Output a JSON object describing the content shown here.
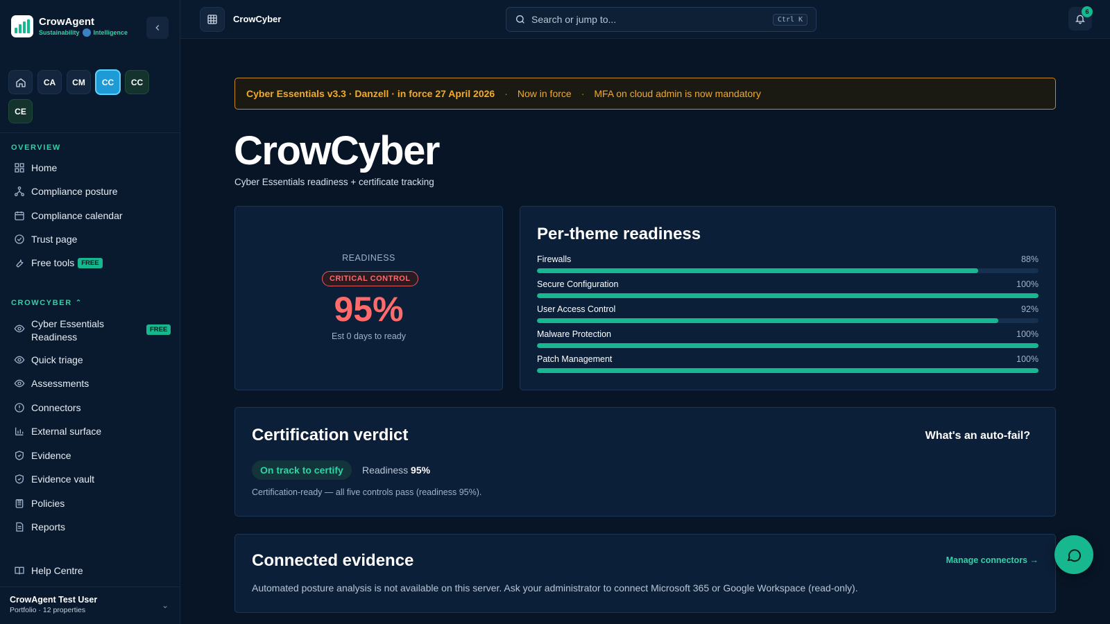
{
  "brand": {
    "name": "CrowAgent",
    "sub_left": "Sustainability",
    "sub_right": "Intelligence"
  },
  "app_switcher": [
    {
      "label": "",
      "icon": "home-icon"
    },
    {
      "label": "CA"
    },
    {
      "label": "CM"
    },
    {
      "label": "CC",
      "active": true
    },
    {
      "label": "CC"
    },
    {
      "label": "CE"
    }
  ],
  "sidebar": {
    "overview_label": "OVERVIEW",
    "overview_items": [
      {
        "label": "Home",
        "icon": "grid-icon"
      },
      {
        "label": "Compliance posture",
        "icon": "sitemap-icon"
      },
      {
        "label": "Compliance calendar",
        "icon": "calendar-icon"
      },
      {
        "label": "Trust page",
        "icon": "check-circle-icon"
      },
      {
        "label": "Free tools",
        "icon": "wrench-icon",
        "badge": "FREE"
      }
    ],
    "section_label": "CROWCYBER",
    "section_items": [
      {
        "label": "Cyber Essentials Readiness",
        "icon": "eye-icon",
        "badge": "FREE"
      },
      {
        "label": "Quick triage",
        "icon": "eye-icon"
      },
      {
        "label": "Assessments",
        "icon": "eye-icon"
      },
      {
        "label": "Connectors",
        "icon": "alert-circle-icon"
      },
      {
        "label": "External surface",
        "icon": "bar-chart-icon"
      },
      {
        "label": "Evidence",
        "icon": "shield-check-icon"
      },
      {
        "label": "Evidence vault",
        "icon": "shield-check-icon"
      },
      {
        "label": "Policies",
        "icon": "clipboard-icon"
      },
      {
        "label": "Reports",
        "icon": "document-icon"
      }
    ],
    "help_label": "Help Centre",
    "user_name": "CrowAgent Test User",
    "user_sub": "Portfolio · 12 properties"
  },
  "topbar": {
    "title": "CrowCyber",
    "search_placeholder": "Search or jump to...",
    "search_shortcut": "Ctrl K",
    "notification_count": "6"
  },
  "banner": {
    "headline": "Cyber Essentials v3.3 · Danzell · in force 27 April 2026",
    "status": "Now in force",
    "note": "MFA on cloud admin is now mandatory",
    "separator": "·"
  },
  "page": {
    "title": "CrowCyber",
    "subtitle": "Cyber Essentials readiness + certificate tracking"
  },
  "readiness": {
    "label": "READINESS",
    "badge": "CRITICAL CONTROL",
    "value": "95%",
    "estimate": "Est 0 days to ready"
  },
  "themes": {
    "title": "Per-theme readiness",
    "rows": [
      {
        "name": "Firewalls",
        "value": "88%",
        "pct": 88
      },
      {
        "name": "Secure Configuration",
        "value": "100%",
        "pct": 100
      },
      {
        "name": "User Access Control",
        "value": "92%",
        "pct": 92
      },
      {
        "name": "Malware Protection",
        "value": "100%",
        "pct": 100
      },
      {
        "name": "Patch Management",
        "value": "100%",
        "pct": 100
      }
    ]
  },
  "verdict": {
    "title": "Certification verdict",
    "link": "What's an auto-fail?",
    "status": "On track to certify",
    "readiness_label": "Readiness",
    "readiness_value": "95%",
    "note": "Certification-ready — all five controls pass (readiness 95%)."
  },
  "evidence": {
    "title": "Connected evidence",
    "link": "Manage connectors →",
    "note": "Automated posture analysis is not available on this server. Ask your administrator to connect Microsoft 365 or Google Workspace (read-only)."
  },
  "colors": {
    "accent": "#17b890",
    "warning": "#f4a928",
    "critical": "#ff6b6b",
    "background": "#071526"
  }
}
